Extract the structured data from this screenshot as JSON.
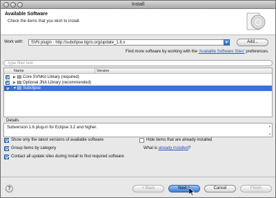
{
  "window": {
    "title": "Install"
  },
  "header": {
    "title": "Available Software",
    "description": "Check the items that you wish to install."
  },
  "work_with": {
    "label": "Work with:",
    "value": "SVN plugin - http://subclipse.tigris.org/update_1.6.x",
    "add_label": "Add...",
    "find_more_prefix": "Find more software by working with the ",
    "find_more_link": "'Available Software Sites'",
    "find_more_suffix": " preferences."
  },
  "filter": {
    "placeholder": "type filter text"
  },
  "tree": {
    "columns": [
      "Name",
      "Version"
    ],
    "rows": [
      {
        "label": "Core SVNKit Library (required)",
        "checked": true,
        "expanded": false,
        "selected": false
      },
      {
        "label": "Optional JNA Library (recommended)",
        "checked": true,
        "expanded": false,
        "selected": false
      },
      {
        "label": "Subclipse",
        "checked": true,
        "expanded": true,
        "selected": true
      }
    ]
  },
  "details": {
    "label": "Details",
    "text": "Subversion 1.6 plug-in for Eclipse 3.2 and higher."
  },
  "options": {
    "show_latest": {
      "label": "Show only the latest versions of available software",
      "checked": true
    },
    "group_by_category": {
      "label": "Group items by category",
      "checked": true
    },
    "contact_all": {
      "label": "Contact all update sites during install to find required software",
      "checked": true
    },
    "hide_installed": {
      "label": "Hide items that are already installed",
      "checked": false
    },
    "what_is_prefix": "What is ",
    "what_is_link": "already installed",
    "what_is_suffix": "?"
  },
  "footer": {
    "help_label": "?",
    "back_label": "< Back",
    "next_label": "Next >",
    "cancel_label": "Cancel",
    "finish_label": "Finish"
  },
  "colors": {
    "selection": "#3875d7",
    "link": "#2a4fb8",
    "primary_button": "#3a7ed8"
  }
}
